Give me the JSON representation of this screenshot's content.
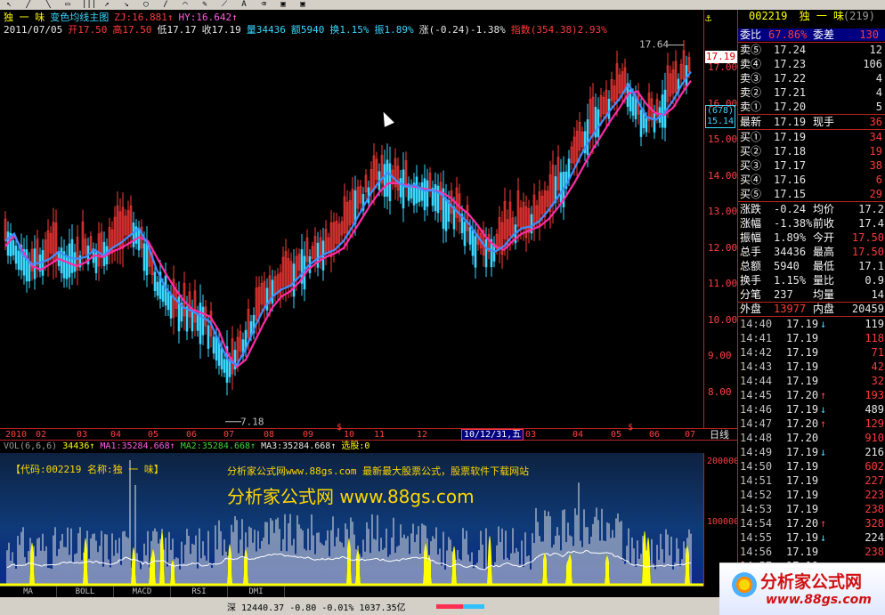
{
  "toolbar": {
    "icons": [
      "pointer-icon",
      "draw-line-icon",
      "draw-line-icon",
      "draw-rect-icon",
      "draw-bars-icon",
      "arrow-icon",
      "arrow-icon",
      "draw-ellipse-icon",
      "draw-line-icon",
      "draw-arc-icon",
      "draw-pencil-icon",
      "draw-ray-icon",
      "text-icon",
      "eraser-icon",
      "save-icon",
      "save-icon"
    ]
  },
  "header": {
    "stock_name": "独 一 味",
    "indicator_name": "变色均线主图",
    "zj": "ZJ:16.881↑",
    "hy": "HY:16.642↑",
    "date": "2011/07/05",
    "open": "开17.50",
    "high": "高17.50",
    "low": "低17.17",
    "close": "收17.19",
    "volume": "量34436",
    "amount": "额5940",
    "turnover": "换1.15%",
    "amplitude": "振1.89%",
    "change": "涨(-0.24)-1.38%",
    "index": "指数(354.38)2.93%"
  },
  "price_axis": {
    "labels": [
      "17.00",
      "16.00",
      "15.00",
      "14.00",
      "13.00",
      "12.00",
      "11.00",
      "10.00",
      "9.00",
      "8.00"
    ],
    "current_price": "17.19",
    "count_box": "(678)",
    "count_price": "15.14",
    "high_label": "17.64",
    "low_label": "7.18"
  },
  "date_axis": {
    "labels": [
      "2010",
      "02",
      "03",
      "04",
      "05",
      "06",
      "07",
      "08",
      "09",
      "10",
      "11",
      "12",
      "03",
      "04",
      "05",
      "06",
      "07"
    ],
    "highlight": "10/12/31,五",
    "period": "日线",
    "s_marks": [
      "$",
      "$"
    ]
  },
  "volume": {
    "header_name": "VOL(6,6,6)",
    "header_val": "34436↑",
    "ma1": "MA1:35284.668↑",
    "ma2": "MA2:35284.668↑",
    "ma3": "MA3:35284.668↑",
    "extra": "选股:0",
    "axis_labels": [
      "200000",
      "100000"
    ],
    "wm_code": "【代码:002219 名称:独 一 味】",
    "wm_site": "分析家公式网www.88gs.com 最新最大股票公式，股票软件下载网站",
    "wm_big": "分析家公式网 www.88gs.com"
  },
  "tabs": [
    "MA",
    "BOLL",
    "MACD",
    "RSI",
    "DMI"
  ],
  "status": {
    "text": "深 12440.37  -0.80  -0.01%  1037.35亿"
  },
  "quote": {
    "code": "002219",
    "name": "独 一 味",
    "count": "(219)",
    "ratio_label": "委比",
    "ratio_val": "67.86%",
    "diff_label": "委差",
    "diff_val": "130",
    "asks": [
      {
        "label": "卖⑤",
        "price": "17.24",
        "vol": "12"
      },
      {
        "label": "卖④",
        "price": "17.23",
        "vol": "106"
      },
      {
        "label": "卖③",
        "price": "17.22",
        "vol": "4"
      },
      {
        "label": "卖②",
        "price": "17.21",
        "vol": "4"
      },
      {
        "label": "卖①",
        "price": "17.20",
        "vol": "5"
      }
    ],
    "last": {
      "label": "最新",
      "price": "17.19",
      "label2": "现手",
      "val2": "36"
    },
    "bids": [
      {
        "label": "买①",
        "price": "17.19",
        "vol": "34"
      },
      {
        "label": "买②",
        "price": "17.18",
        "vol": "19"
      },
      {
        "label": "买③",
        "price": "17.17",
        "vol": "38"
      },
      {
        "label": "买④",
        "price": "17.16",
        "vol": "6"
      },
      {
        "label": "买⑤",
        "price": "17.15",
        "vol": "29"
      }
    ],
    "stats": [
      {
        "l1": "涨跌",
        "v1": "-0.24",
        "l2": "均价",
        "v2": "17.2"
      },
      {
        "l1": "涨幅",
        "v1": "-1.38%",
        "l2": "前收",
        "v2": "17.4"
      },
      {
        "l1": "振幅",
        "v1": "1.89%",
        "l2": "今开",
        "v2": "17.50"
      },
      {
        "l1": "总手",
        "v1": "34436",
        "l2": "最高",
        "v2": "17.50"
      },
      {
        "l1": "总额",
        "v1": "5940",
        "l2": "最低",
        "v2": "17.1"
      },
      {
        "l1": "换手",
        "v1": "1.15%",
        "l2": "量比",
        "v2": "0.9"
      },
      {
        "l1": "分笔",
        "v1": "237",
        "l2": "均量",
        "v2": "14"
      }
    ],
    "outer_label": "外盘",
    "outer_val": "13977",
    "inner_label": "内盘",
    "inner_val": "20459",
    "ticks": [
      {
        "time": "14:40",
        "price": "17.19",
        "arrow": "↓",
        "vol": "119"
      },
      {
        "time": "14:41",
        "price": "17.19",
        "arrow": "",
        "vol": "118"
      },
      {
        "time": "14:42",
        "price": "17.19",
        "arrow": "",
        "vol": "71"
      },
      {
        "time": "14:43",
        "price": "17.19",
        "arrow": "",
        "vol": "42"
      },
      {
        "time": "14:44",
        "price": "17.19",
        "arrow": "",
        "vol": "32"
      },
      {
        "time": "14:45",
        "price": "17.20",
        "arrow": "↑",
        "vol": "193"
      },
      {
        "time": "14:46",
        "price": "17.19",
        "arrow": "↓",
        "vol": "489"
      },
      {
        "time": "14:47",
        "price": "17.20",
        "arrow": "↑",
        "vol": "129"
      },
      {
        "time": "14:48",
        "price": "17.20",
        "arrow": "",
        "vol": "910"
      },
      {
        "time": "14:49",
        "price": "17.19",
        "arrow": "↓",
        "vol": "216"
      },
      {
        "time": "14:50",
        "price": "17.19",
        "arrow": "",
        "vol": "602"
      },
      {
        "time": "14:51",
        "price": "17.19",
        "arrow": "",
        "vol": "227"
      },
      {
        "time": "14:52",
        "price": "17.19",
        "arrow": "",
        "vol": "223"
      },
      {
        "time": "14:53",
        "price": "17.19",
        "arrow": "",
        "vol": "238"
      },
      {
        "time": "14:54",
        "price": "17.20",
        "arrow": "↑",
        "vol": "328"
      },
      {
        "time": "14:55",
        "price": "17.19",
        "arrow": "↓",
        "vol": "224"
      },
      {
        "time": "14:56",
        "price": "17.19",
        "arrow": "",
        "vol": "238"
      },
      {
        "time": "14:57",
        "price": "17.19",
        "arrow": "",
        "vol": ""
      }
    ]
  },
  "logo": {
    "cn": "分析家公式网",
    "url": "www.88gs.com"
  },
  "colors": {
    "up": "#ff3a3a",
    "down": "#3ad7ff",
    "ma_fast": "#3f8dff",
    "ma_slow": "#ff2aa8",
    "volume_hl": "#ffff00"
  },
  "chart_data": {
    "type": "line",
    "description_series": [
      {
        "name": "HY",
        "points": [
          [
            0,
            12.05
          ],
          [
            10,
            12.35
          ],
          [
            20,
            11.9
          ],
          [
            30,
            11.5
          ],
          [
            40,
            11.4
          ],
          [
            50,
            11.55
          ],
          [
            60,
            11.7
          ],
          [
            70,
            11.6
          ],
          [
            80,
            11.5
          ],
          [
            90,
            11.6
          ],
          [
            100,
            11.8
          ],
          [
            110,
            11.75
          ],
          [
            120,
            11.9
          ],
          [
            130,
            12.0
          ],
          [
            140,
            12.15
          ],
          [
            150,
            12.3
          ],
          [
            160,
            12.2
          ],
          [
            170,
            11.75
          ],
          [
            180,
            11.3
          ],
          [
            190,
            10.9
          ],
          [
            200,
            10.55
          ],
          [
            210,
            10.3
          ],
          [
            220,
            10.2
          ],
          [
            230,
            10.1
          ],
          [
            240,
            9.7
          ],
          [
            250,
            9.05
          ],
          [
            260,
            8.7
          ],
          [
            270,
            8.9
          ],
          [
            280,
            9.4
          ],
          [
            290,
            9.9
          ],
          [
            300,
            10.35
          ],
          [
            310,
            10.65
          ],
          [
            320,
            10.8
          ],
          [
            330,
            11.05
          ],
          [
            340,
            11.4
          ],
          [
            350,
            11.6
          ],
          [
            360,
            11.75
          ],
          [
            370,
            11.85
          ],
          [
            380,
            12.0
          ],
          [
            390,
            12.4
          ],
          [
            400,
            12.8
          ],
          [
            410,
            13.2
          ],
          [
            420,
            13.55
          ],
          [
            430,
            13.8
          ],
          [
            440,
            13.8
          ],
          [
            450,
            13.75
          ],
          [
            460,
            13.7
          ],
          [
            470,
            13.65
          ],
          [
            480,
            13.6
          ],
          [
            490,
            13.55
          ],
          [
            500,
            13.4
          ],
          [
            510,
            13.15
          ],
          [
            520,
            12.95
          ],
          [
            530,
            12.65
          ],
          [
            540,
            12.3
          ],
          [
            550,
            12.05
          ],
          [
            560,
            11.95
          ],
          [
            570,
            12.2
          ],
          [
            580,
            12.4
          ],
          [
            590,
            12.5
          ],
          [
            600,
            12.6
          ],
          [
            610,
            12.8
          ],
          [
            620,
            13.1
          ],
          [
            630,
            13.45
          ],
          [
            640,
            13.85
          ],
          [
            650,
            14.3
          ],
          [
            660,
            14.75
          ],
          [
            670,
            15.15
          ],
          [
            680,
            15.55
          ],
          [
            690,
            15.9
          ],
          [
            700,
            16.3
          ],
          [
            710,
            16.35
          ],
          [
            720,
            16.0
          ],
          [
            730,
            15.75
          ],
          [
            740,
            15.7
          ],
          [
            750,
            15.9
          ],
          [
            760,
            16.3
          ],
          [
            770,
            16.65
          ]
        ]
      },
      {
        "name": "ZJ",
        "points": [
          [
            0,
            12.2
          ],
          [
            10,
            12.4
          ],
          [
            20,
            11.8
          ],
          [
            30,
            11.55
          ],
          [
            40,
            11.6
          ],
          [
            50,
            11.7
          ],
          [
            60,
            11.9
          ],
          [
            70,
            11.75
          ],
          [
            80,
            11.7
          ],
          [
            90,
            11.75
          ],
          [
            100,
            11.95
          ],
          [
            110,
            11.8
          ],
          [
            120,
            12.0
          ],
          [
            130,
            12.15
          ],
          [
            140,
            12.35
          ],
          [
            150,
            12.55
          ],
          [
            160,
            12.1
          ],
          [
            170,
            11.4
          ],
          [
            180,
            10.9
          ],
          [
            190,
            10.6
          ],
          [
            200,
            10.35
          ],
          [
            210,
            10.25
          ],
          [
            220,
            10.1
          ],
          [
            230,
            9.95
          ],
          [
            240,
            9.4
          ],
          [
            250,
            8.9
          ],
          [
            260,
            8.75
          ],
          [
            270,
            9.2
          ],
          [
            280,
            9.8
          ],
          [
            290,
            10.3
          ],
          [
            300,
            10.65
          ],
          [
            310,
            10.85
          ],
          [
            320,
            10.95
          ],
          [
            330,
            11.2
          ],
          [
            340,
            11.5
          ],
          [
            350,
            11.7
          ],
          [
            360,
            11.85
          ],
          [
            370,
            11.95
          ],
          [
            380,
            12.2
          ],
          [
            390,
            12.6
          ],
          [
            400,
            13.05
          ],
          [
            410,
            13.5
          ],
          [
            420,
            13.85
          ],
          [
            430,
            14.1
          ],
          [
            440,
            13.85
          ],
          [
            450,
            13.7
          ],
          [
            460,
            13.75
          ],
          [
            470,
            13.6
          ],
          [
            480,
            13.6
          ],
          [
            490,
            13.5
          ],
          [
            500,
            13.2
          ],
          [
            510,
            12.95
          ],
          [
            520,
            12.7
          ],
          [
            530,
            12.35
          ],
          [
            540,
            12.0
          ],
          [
            550,
            11.9
          ],
          [
            560,
            12.05
          ],
          [
            570,
            12.35
          ],
          [
            580,
            12.55
          ],
          [
            590,
            12.6
          ],
          [
            600,
            12.75
          ],
          [
            610,
            13.05
          ],
          [
            620,
            13.4
          ],
          [
            630,
            13.75
          ],
          [
            640,
            14.25
          ],
          [
            650,
            14.75
          ],
          [
            660,
            15.15
          ],
          [
            670,
            15.5
          ],
          [
            680,
            15.85
          ],
          [
            690,
            16.15
          ],
          [
            700,
            16.55
          ],
          [
            710,
            16.1
          ],
          [
            720,
            15.65
          ],
          [
            730,
            15.55
          ],
          [
            740,
            15.75
          ],
          [
            750,
            16.1
          ],
          [
            760,
            16.55
          ],
          [
            770,
            16.9
          ]
        ]
      }
    ],
    "ylim": [
      7.0,
      18.0
    ],
    "yticks": [
      8,
      9,
      10,
      11,
      12,
      13,
      14,
      15,
      16,
      17
    ],
    "high": 17.64,
    "low": 7.18
  }
}
